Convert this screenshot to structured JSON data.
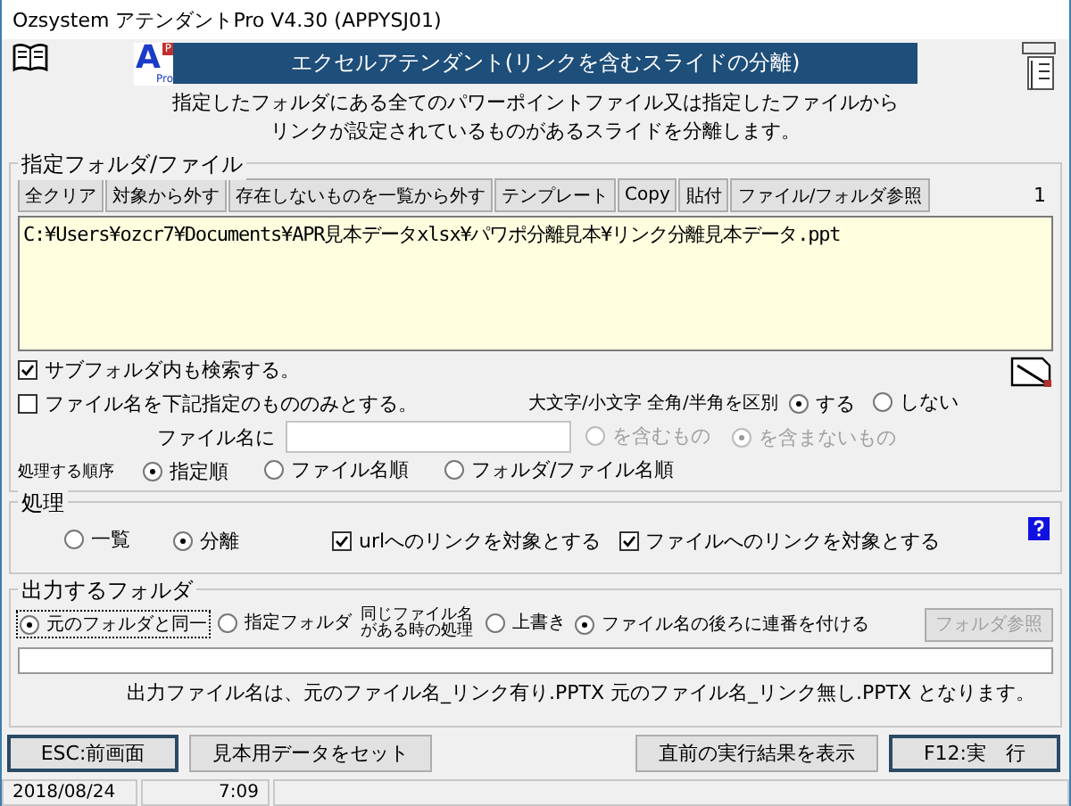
{
  "window": {
    "title": "Ozsystem アテンダントPro V4.30 (APPYSJ01)"
  },
  "header": {
    "logo_letter": "A",
    "logo_badge": "P",
    "logo_sub": "Pro",
    "banner": "エクセルアテンダント(リンクを含むスライドの分離)",
    "description": [
      "指定したフォルダにある全てのパワーポイントファイル又は指定したファイルから",
      "リンクが設定されているものがあるスライドを分離します。"
    ]
  },
  "target_group": {
    "legend": "指定フォルダ/ファイル",
    "buttons": [
      "全クリア",
      "対象から外す",
      "存在しないものを一覧から外す",
      "テンプレート",
      "Copy",
      "貼付",
      "ファイル/フォルダ参照"
    ],
    "count": "1",
    "file_list": [
      "C:¥Users¥ozcr7¥Documents¥APR見本データxlsx¥パワポ分離見本¥リンク分離見本データ.ppt"
    ],
    "include_subfolders": {
      "label": "サブフォルダ内も検索する。",
      "checked": true
    },
    "filter_filenames": {
      "label": "ファイル名を下記指定のもののみとする。",
      "checked": false
    },
    "case_sensitivity": {
      "label": "大文字/小文字 全角/半角を区別",
      "options": [
        {
          "label": "する",
          "selected": true
        },
        {
          "label": "しない",
          "selected": false
        }
      ]
    },
    "filename_filter": {
      "label": "ファイル名に",
      "disabled": true,
      "options": [
        {
          "label": "を含むもの",
          "selected": false
        },
        {
          "label": "を含まないもの",
          "selected": true
        }
      ]
    },
    "order": {
      "label": "処理する順序",
      "options": [
        {
          "label": "指定順",
          "selected": true
        },
        {
          "label": "ファイル名順",
          "selected": false
        },
        {
          "label": "フォルダ/ファイル名順",
          "selected": false
        }
      ]
    }
  },
  "process_group": {
    "legend": "処理",
    "modes": [
      {
        "label": "一覧",
        "selected": false
      },
      {
        "label": "分離",
        "selected": true
      }
    ],
    "targets": [
      {
        "label": "urlへのリンクを対象とする",
        "checked": true
      },
      {
        "label": "ファイルへのリンクを対象とする",
        "checked": true
      }
    ]
  },
  "output_group": {
    "legend": "出力するフォルダ",
    "destinations": [
      {
        "label": "元のフォルダと同一",
        "selected": true,
        "focused": true
      },
      {
        "label": "指定フォルダ",
        "selected": false,
        "focused": false
      }
    ],
    "duplicate_label": [
      "同じファイル名",
      "がある時の処理"
    ],
    "duplicate_options": [
      {
        "label": "上書き",
        "selected": false
      },
      {
        "label": "ファイル名の後ろに連番を付ける",
        "selected": true
      }
    ],
    "browse_button": {
      "label": "フォルダ参照",
      "disabled": true
    },
    "note": "出力ファイル名は、元のファイル名_リンク有り.PPTX  元のファイル名_リンク無し.PPTX となります。"
  },
  "footer": {
    "left": [
      {
        "label": "ESC:前画面",
        "emphasized": true
      },
      {
        "label": "見本用データをセット",
        "emphasized": false
      }
    ],
    "right": [
      {
        "label": "直前の実行結果を表示",
        "emphasized": false
      },
      {
        "label": "F12:実　行",
        "emphasized": true
      }
    ]
  },
  "status_bar": [
    "2018/08/24",
    "7:09"
  ]
}
